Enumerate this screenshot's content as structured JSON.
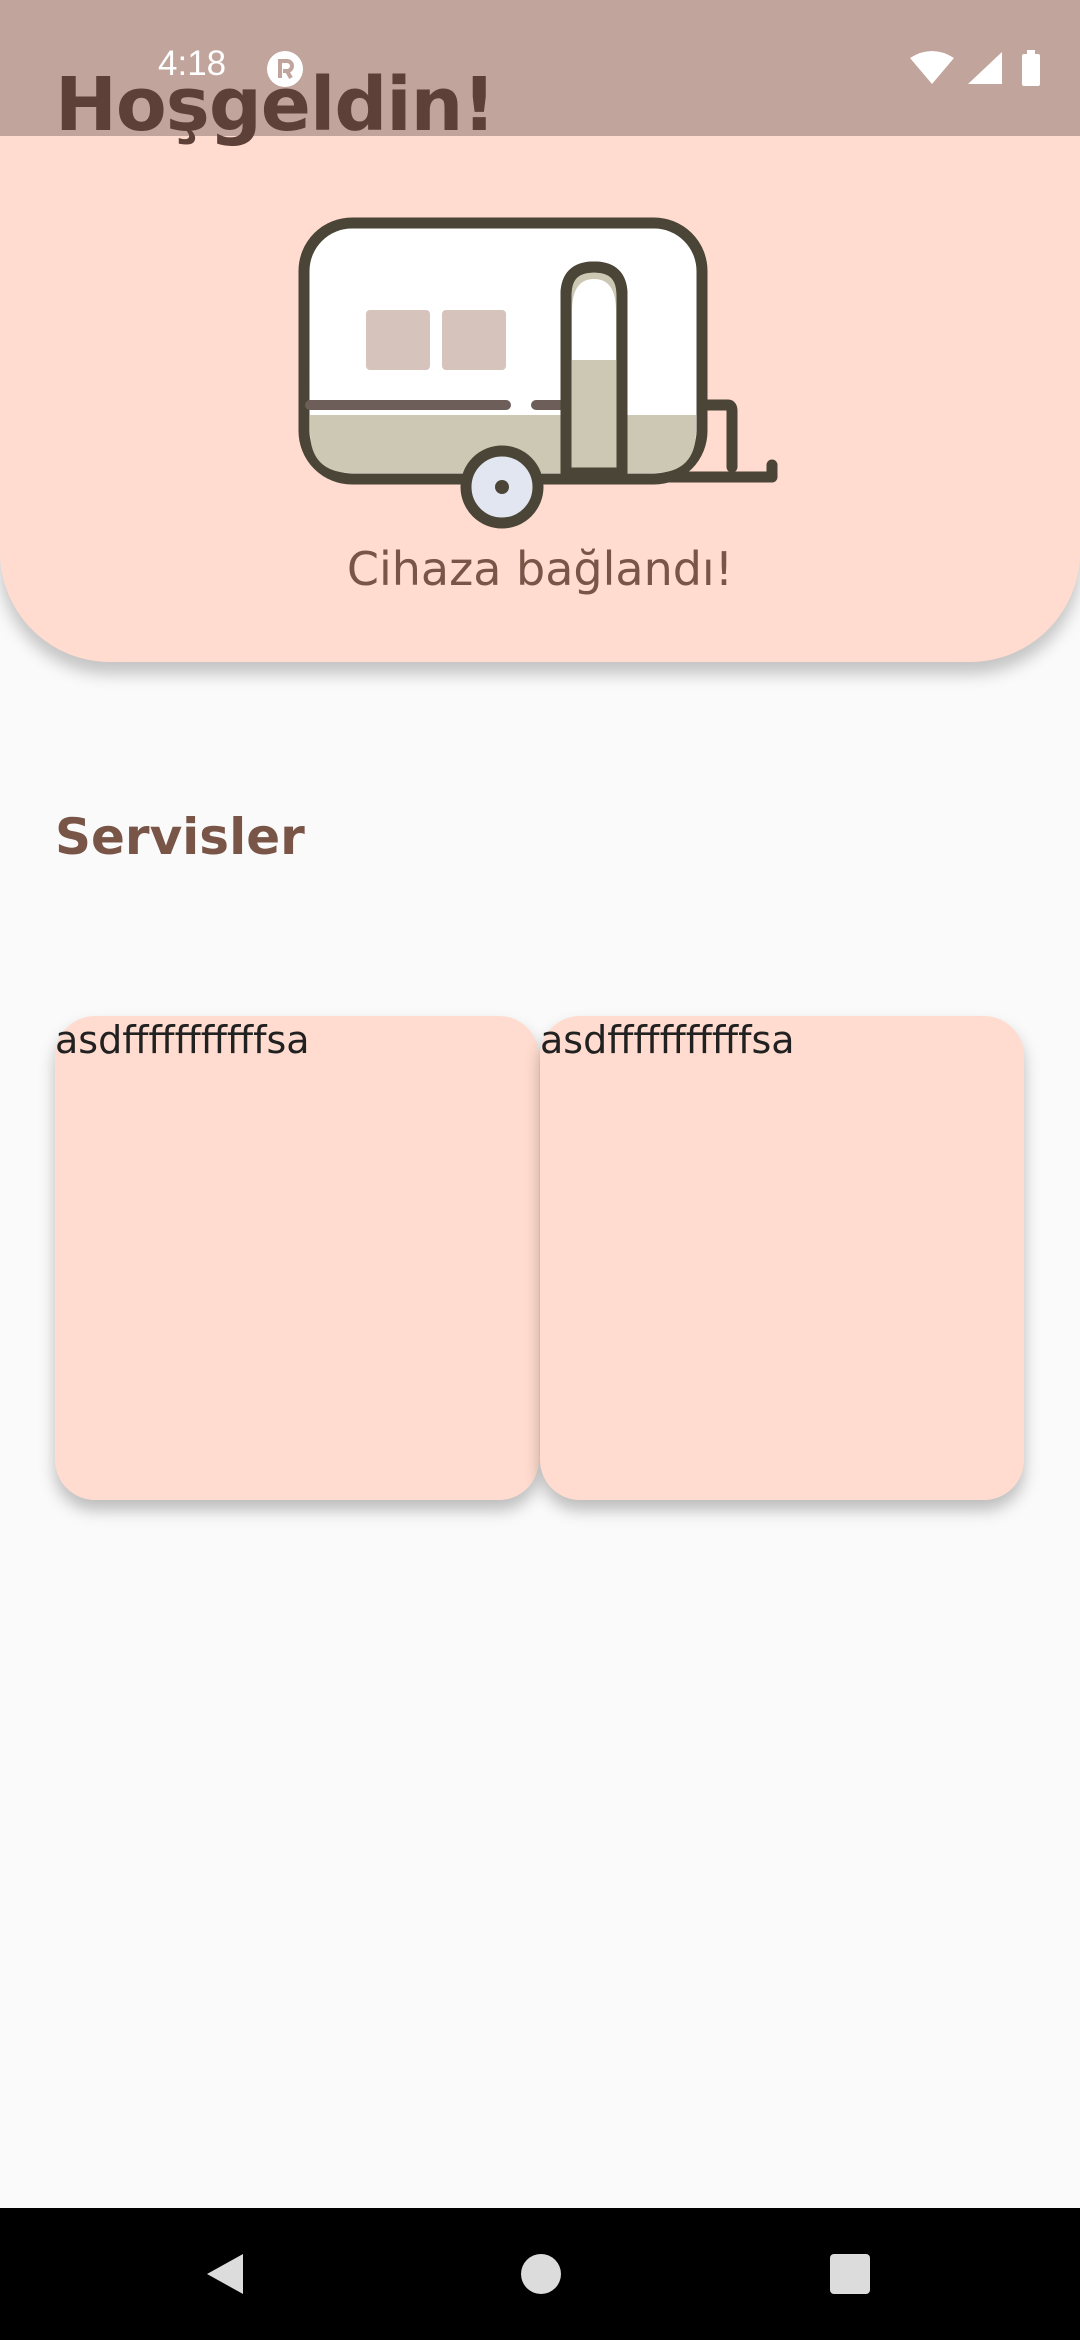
{
  "status_bar": {
    "time": "4:18",
    "icons": [
      "app-notification-icon",
      "wifi-icon",
      "signal-icon",
      "battery-icon"
    ]
  },
  "header": {
    "title": "Hoşgeldin!",
    "image_icon": "caravan-icon",
    "status": "Cihaza bağlandı!"
  },
  "services": {
    "title": "Servisler",
    "cards": [
      {
        "label": "asdfffffffffffsa"
      },
      {
        "label": "asdfffffffffffsa"
      }
    ]
  },
  "navigation": {
    "buttons": [
      "back-icon",
      "home-icon",
      "recents-icon"
    ]
  },
  "colors": {
    "status_bar": "#c1a49b",
    "header_bg": "#ffdccf",
    "title": "#5d4037",
    "accent_text": "#795548",
    "page_bg": "#fafafa"
  }
}
